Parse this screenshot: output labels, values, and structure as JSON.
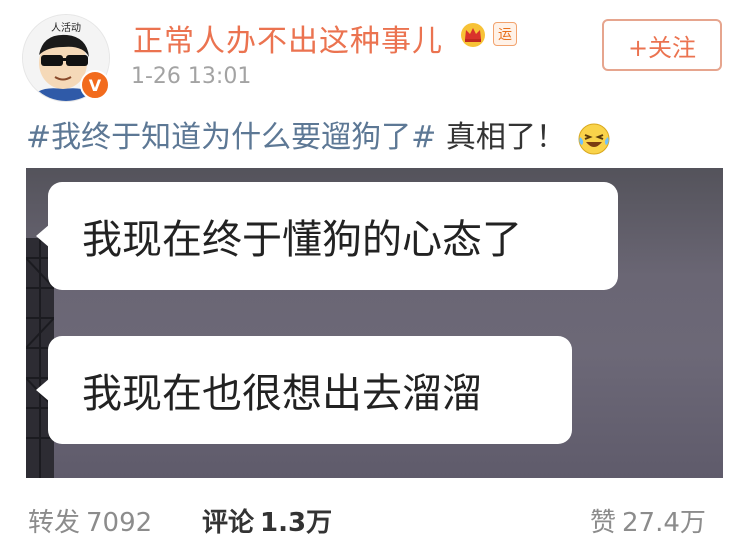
{
  "post": {
    "username": "正常人办不出这种事儿",
    "time": "1-26 13:01",
    "follow_label": "+关注",
    "badge_label": "V",
    "badge_yun": "运",
    "avatar_text": "人活动",
    "hashtag": "#我终于知道为什么要遛狗了#",
    "text": " 真相了！",
    "emoji": "laughing-tears-emoji"
  },
  "image": {
    "bubble1": "我现在终于懂狗的心态了",
    "bubble2": "我现在也很想出去溜溜"
  },
  "stats": {
    "repost_label": "转发",
    "repost_count": "7092",
    "comment_label": "评论",
    "comment_count": "1.3万",
    "like_label": "赞",
    "like_count": "27.4万"
  },
  "colors": {
    "username": "#eb7350",
    "hashtag": "#5d7895",
    "verified": "#f26b1d"
  }
}
